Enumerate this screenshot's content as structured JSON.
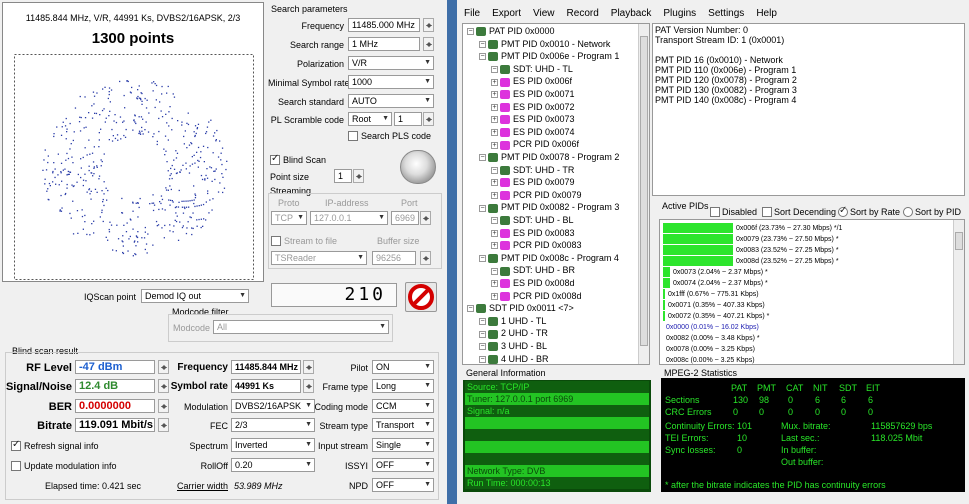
{
  "left": {
    "constellation_header": "11485.844 MHz, V/R, 44991 Ks, DVBS2/16APSK, 2/3",
    "points_title": "1300 points",
    "iqscan_label": "IQScan point",
    "iqscan_value": "Demod IQ out",
    "modcode_filter_label": "Modcode filter",
    "modcode_label": "Modcode",
    "modcode_value": "All",
    "counter_value": "210"
  },
  "search": {
    "title": "Search parameters",
    "frequency_label": "Frequency",
    "frequency_value": "11485.000 MHz",
    "range_label": "Search range",
    "range_value": "1 MHz",
    "polarization_label": "Polarization",
    "polarization_value": "V/R",
    "minsym_label": "Minimal Symbol rate",
    "minsym_value": "1000",
    "standard_label": "Search standard",
    "standard_value": "AUTO",
    "pls_label": "PL Scramble code",
    "pls_value": "Root",
    "pls_num": "1",
    "search_pls_label": "Search PLS code",
    "blind_scan_label": "Blind Scan",
    "point_size_label": "Point size",
    "point_size_value": "1",
    "streaming_label": "Streaming",
    "proto_label": "Proto",
    "ip_label": "IP-address",
    "port_label": "Port",
    "proto_value": "TCP",
    "ip_value": "127.0.0.1",
    "port_value": "6969",
    "stream_file_label": "Stream to file",
    "buffer_label": "Buffer size",
    "tsreader_value": "TSReader",
    "buffer_value": "96256"
  },
  "result": {
    "title": "Blind scan result",
    "rf_label": "RF Level",
    "rf_value": "-47 dBm",
    "sn_label": "Signal/Noise",
    "sn_value": "12.4 dB",
    "ber_label": "BER",
    "ber_value": "0.0000000",
    "bitrate_label": "Bitrate",
    "bitrate_value": "119.091 Mbit/s",
    "freq_label": "Frequency",
    "freq_value": "11485.844 MHz",
    "sym_label": "Symbol rate",
    "sym_value": "44991 Ks",
    "mod_label": "Modulation",
    "mod_value": "DVBS2/16APSK",
    "fec_label": "FEC",
    "fec_value": "2/3",
    "spectrum_label": "Spectrum",
    "spectrum_value": "Inverted",
    "rolloff_label": "RollOff",
    "rolloff_value": "0.20",
    "carrier_label": "Carrier width",
    "carrier_value": "53.989 MHz",
    "pilot_label": "Pilot",
    "pilot_value": "ON",
    "frame_label": "Frame type",
    "frame_value": "Long",
    "coding_label": "Coding mode",
    "coding_value": "CCM",
    "stream_type_label": "Stream type",
    "stream_type_value": "Transport",
    "input_stream_label": "Input stream",
    "input_stream_value": "Single",
    "issyi_label": "ISSYI",
    "issyi_value": "OFF",
    "npd_label": "NPD",
    "npd_value": "OFF",
    "refresh_label": "Refresh signal info",
    "update_label": "Update modulation info",
    "elapsed": "Elapsed time: 0.421 sec"
  },
  "menu": [
    "File",
    "Export",
    "View",
    "Record",
    "Playback",
    "Plugins",
    "Settings",
    "Help"
  ],
  "tree": [
    {
      "t": "PAT PID 0x0000",
      "lvl": 0,
      "ic": "db"
    },
    {
      "t": "PMT PID 0x0010 - Network",
      "lvl": 1,
      "ic": "db"
    },
    {
      "t": "PMT PID 0x006e - Program 1",
      "lvl": 1,
      "ic": "db"
    },
    {
      "t": "SDT: UHD - TL",
      "lvl": 2,
      "ic": "db"
    },
    {
      "t": "ES PID 0x006f",
      "lvl": 2,
      "ic": "pk"
    },
    {
      "t": "ES PID 0x0071",
      "lvl": 2,
      "ic": "pk"
    },
    {
      "t": "ES PID 0x0072",
      "lvl": 2,
      "ic": "pk"
    },
    {
      "t": "ES PID 0x0073",
      "lvl": 2,
      "ic": "pk"
    },
    {
      "t": "ES PID 0x0074",
      "lvl": 2,
      "ic": "pk"
    },
    {
      "t": "PCR PID 0x006f",
      "lvl": 2,
      "ic": "pk"
    },
    {
      "t": "PMT PID 0x0078 - Program 2",
      "lvl": 1,
      "ic": "db"
    },
    {
      "t": "SDT: UHD - TR",
      "lvl": 2,
      "ic": "db"
    },
    {
      "t": "ES PID 0x0079",
      "lvl": 2,
      "ic": "pk"
    },
    {
      "t": "PCR PID 0x0079",
      "lvl": 2,
      "ic": "pk"
    },
    {
      "t": "PMT PID 0x0082 - Program 3",
      "lvl": 1,
      "ic": "db"
    },
    {
      "t": "SDT: UHD - BL",
      "lvl": 2,
      "ic": "db"
    },
    {
      "t": "ES PID 0x0083",
      "lvl": 2,
      "ic": "pk"
    },
    {
      "t": "PCR PID 0x0083",
      "lvl": 2,
      "ic": "pk"
    },
    {
      "t": "PMT PID 0x008c - Program 4",
      "lvl": 1,
      "ic": "db"
    },
    {
      "t": "SDT: UHD - BR",
      "lvl": 2,
      "ic": "db"
    },
    {
      "t": "ES PID 0x008d",
      "lvl": 2,
      "ic": "pk"
    },
    {
      "t": "PCR PID 0x008d",
      "lvl": 2,
      "ic": "pk"
    },
    {
      "t": "SDT PID 0x0011 <7>",
      "lvl": 0,
      "ic": "db"
    },
    {
      "t": "1 UHD - TL",
      "lvl": 1,
      "ic": "db"
    },
    {
      "t": "2 UHD - TR",
      "lvl": 1,
      "ic": "db"
    },
    {
      "t": "3 UHD - BL",
      "lvl": 1,
      "ic": "db"
    },
    {
      "t": "4 UHD - BR",
      "lvl": 1,
      "ic": "db"
    }
  ],
  "info": [
    "PAT Version Number: 0",
    "Transport Stream ID: 1 (0x0001)",
    "",
    "PMT PID 16 (0x0010) - Network",
    "PMT PID 110 (0x006e) - Program 1",
    "PMT PID 120 (0x0078) - Program 2",
    "PMT PID 130 (0x0082) - Program 3",
    "PMT PID 140 (0x008c) - Program 4"
  ],
  "pids": {
    "label": "Active PIDs",
    "disabled": "Disabled",
    "sort_dec": "Sort Decending",
    "sort_rate": "Sort by Rate",
    "sort_pid": "Sort by PID",
    "rows": [
      {
        "t": "0x006f (23.73% ~ 27.30 Mbps) */1",
        "p": 23.73,
        "blue": false
      },
      {
        "t": "0x0079 (23.73% ~ 27.50 Mbps) *",
        "p": 23.73,
        "blue": false
      },
      {
        "t": "0x0083 (23.52% ~ 27.25 Mbps) *",
        "p": 23.52,
        "blue": false
      },
      {
        "t": "0x008d (23.52% ~ 27.25 Mbps) *",
        "p": 23.52,
        "blue": false
      },
      {
        "t": "0x0073 (2.04% ~ 2.37 Mbps) *",
        "p": 2.04,
        "blue": false
      },
      {
        "t": "0x0074 (2.04% ~ 2.37 Mbps) *",
        "p": 2.04,
        "blue": false
      },
      {
        "t": "0x1fff (0.67% ~ 775.31 Kbps)",
        "p": 0.67,
        "blue": false
      },
      {
        "t": "0x0071 (0.35% ~ 407.33 Kbps)",
        "p": 0.35,
        "blue": false
      },
      {
        "t": "0x0072 (0.35% ~ 407.21 Kbps) *",
        "p": 0.35,
        "blue": false
      },
      {
        "t": "0x0000 (0.01% ~ 16.02 Kbps)",
        "p": 0.01,
        "blue": true
      },
      {
        "t": "0x0082 (0.00% ~ 3.48 Kbps) *",
        "p": 0,
        "blue": false
      },
      {
        "t": "0x0078 (0.00% ~ 3.25 Kbps)",
        "p": 0,
        "blue": false
      },
      {
        "t": "0x008c (0.00% ~ 3.25 Kbps)",
        "p": 0,
        "blue": false
      }
    ]
  },
  "general": {
    "title": "General Information",
    "lines": [
      "Source: TCP/IP",
      "Tuner: 127.0.0.1 port 6969",
      "Signal: n/a",
      "",
      "",
      "",
      "",
      "Network Type: DVB",
      "Run Time: 000:00:13"
    ]
  },
  "mpeg": {
    "title": "MPEG-2 Statistics",
    "headers": [
      "PAT",
      "PMT",
      "CAT",
      "NIT",
      "SDT",
      "EIT"
    ],
    "sections_label": "Sections",
    "sections": [
      "130",
      "98",
      "0",
      "6",
      "6",
      "6"
    ],
    "crc_label": "CRC Errors",
    "crc": [
      "0",
      "0",
      "0",
      "0",
      "0",
      "0"
    ],
    "cont_label": "Continuity Errors:",
    "cont_value": "101",
    "mux_label": "Mux. bitrate:",
    "mux_value": "115857629 bps",
    "tei_label": "TEI Errors:",
    "tei_value": "10",
    "last_label": "Last sec.:",
    "last_value": "118.025 Mbit",
    "sync_label": "Sync losses:",
    "sync_value": "0",
    "inbuf_label": "In buffer:",
    "outbuf_label": "Out buffer:",
    "note": "* after the bitrate indicates the PID has continuity errors"
  },
  "colors": {
    "green_bar": "#2de52d",
    "green_bg": "#0a4a0a",
    "green_text": "#29e629",
    "accent": "#1c5fcf",
    "red": "#d40000"
  }
}
